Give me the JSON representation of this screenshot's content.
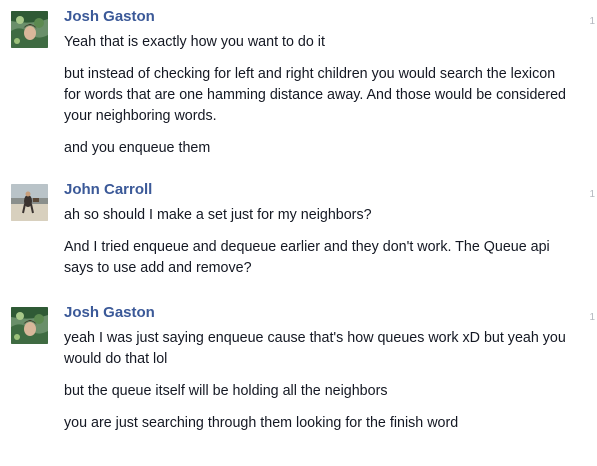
{
  "messages": [
    {
      "sender": "Josh Gaston",
      "avatar": "avatar-josh-green-leaves-icon",
      "indicator": "1",
      "lines": [
        "Yeah that is exactly how you want to do it",
        "but instead of checking for left and right children you would search the lexicon for words that are one hamming distance away. And those would be considered your neighboring words.",
        "and you enqueue them"
      ]
    },
    {
      "sender": "John Carroll",
      "avatar": "avatar-john-beach-icon",
      "indicator": "1",
      "lines": [
        "ah so should I make a set just for my neighbors?",
        "And I tried enqueue and dequeue earlier and they don't work. The Queue api says to use add and remove?"
      ]
    },
    {
      "sender": "Josh Gaston",
      "avatar": "avatar-josh-green-leaves-icon",
      "indicator": "1",
      "lines": [
        "yeah I was just saying enqueue cause that's how queues work xD but yeah you would do that lol",
        "but the queue itself will be holding all the neighbors",
        "you are just searching through them looking for the finish word"
      ]
    }
  ]
}
